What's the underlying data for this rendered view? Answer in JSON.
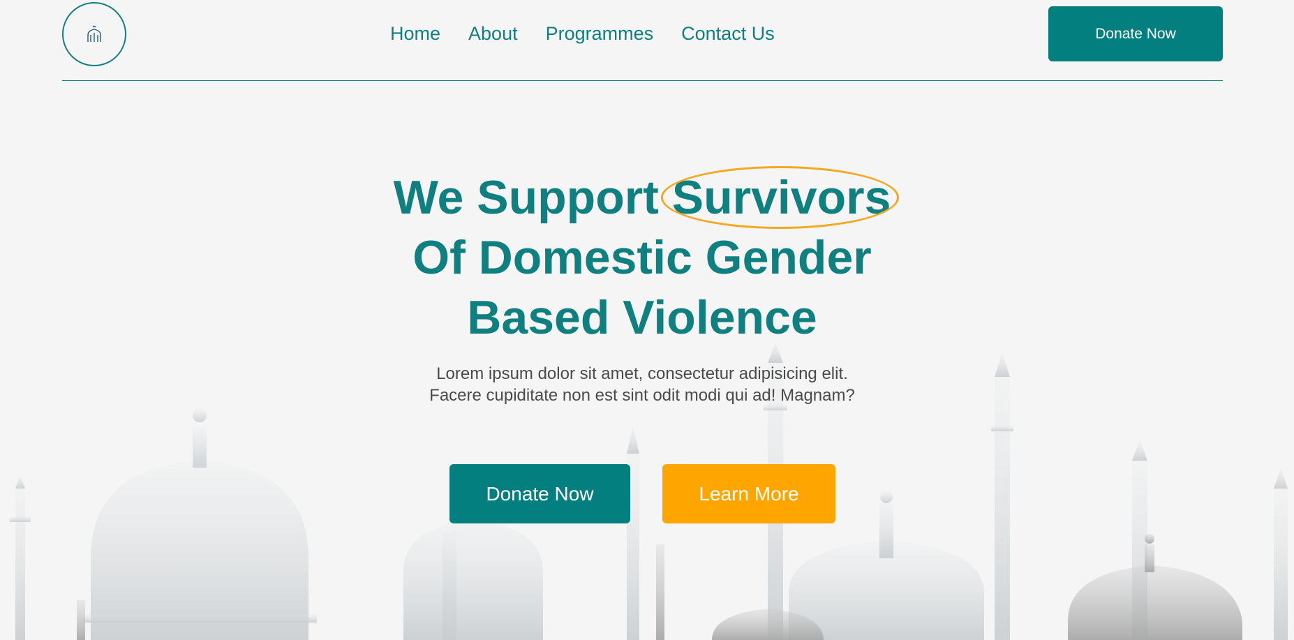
{
  "colors": {
    "brand_teal": "#037f7f",
    "accent_orange": "#ffa500",
    "highlight_ring": "#f5a71e",
    "background": "#f5f5f5",
    "body_text": "#4a4a4a"
  },
  "header": {
    "logo_icon": "mosque-logo-icon",
    "nav": [
      {
        "label": "Home"
      },
      {
        "label": "About"
      },
      {
        "label": "Programmes"
      },
      {
        "label": "Contact Us"
      }
    ],
    "donate_label": "Donate Now"
  },
  "hero": {
    "title_prefix": "We Support ",
    "title_highlight": "Survivors",
    "title_line2": "Of Domestic Gender",
    "title_line3": "Based Violence",
    "subtitle_line1": "Lorem ipsum dolor sit amet, consectetur adipisicing elit.",
    "subtitle_line2": "Facere cupiditate non est sint odit modi qui ad! Magnam?",
    "primary_cta": "Donate Now",
    "secondary_cta": "Learn More"
  }
}
